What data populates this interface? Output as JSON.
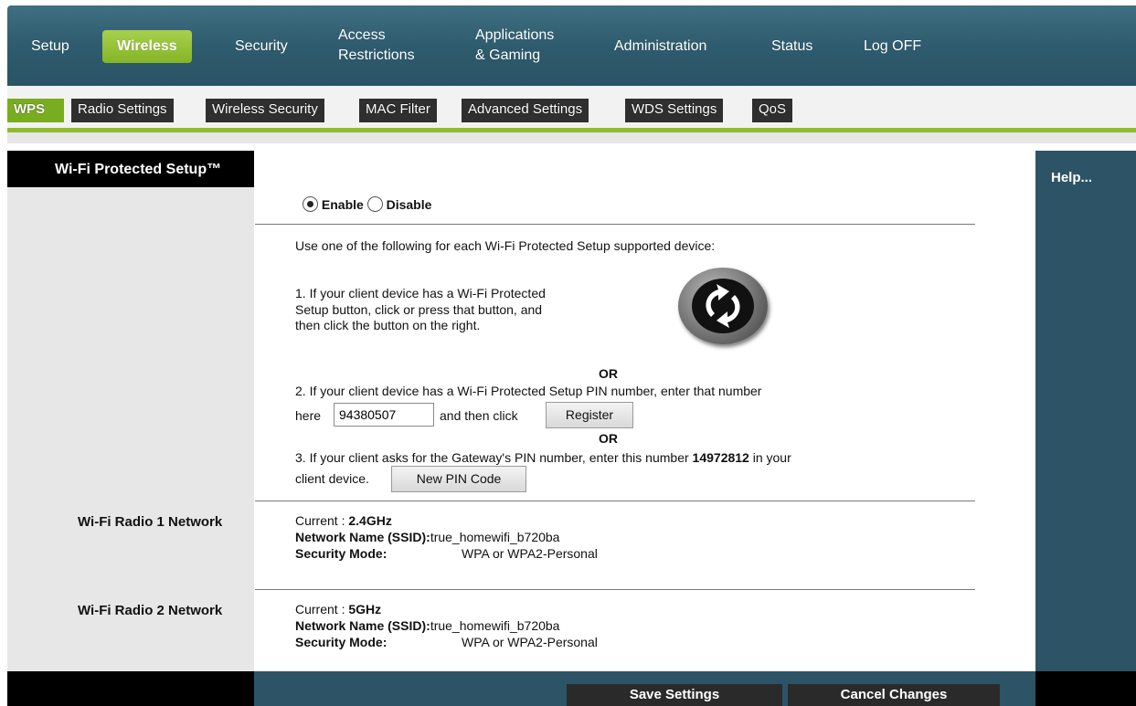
{
  "topnav": {
    "items": [
      {
        "label": "Setup"
      },
      {
        "label": "Wireless",
        "active": true
      },
      {
        "label": "Security"
      },
      {
        "label_line1": "Access",
        "label_line2": "Restrictions"
      },
      {
        "label_line1": "Applications",
        "label_line2": "& Gaming"
      },
      {
        "label": "Administration"
      },
      {
        "label": "Status"
      },
      {
        "label": "Log OFF"
      }
    ]
  },
  "subnav": {
    "tabs": [
      {
        "label": "WPS",
        "active": true
      },
      {
        "label": "Radio Settings"
      },
      {
        "label": "Wireless Security"
      },
      {
        "label": "MAC Filter"
      },
      {
        "label": "Advanced Settings"
      },
      {
        "label": "WDS Settings"
      },
      {
        "label": "QoS"
      }
    ]
  },
  "left": {
    "section_title": "Wi-Fi Protected Setup™",
    "radio1_label": "Wi-Fi Radio 1 Network",
    "radio2_label": "Wi-Fi Radio 2 Network"
  },
  "wps": {
    "enable_label": "Enable",
    "disable_label": "Disable",
    "selected": "Enable",
    "intro": "Use one of the following for each Wi-Fi Protected Setup supported device:",
    "option1_line1": "1. If your client device has a Wi-Fi Protected",
    "option1_line2": "Setup button, click or press that button, and",
    "option1_line3": "then click the button on the right.",
    "or_text": "OR",
    "option2_line1": "2. If your client device has a Wi-Fi Protected Setup PIN number, enter that number",
    "option2_here": "here",
    "pin_value": "94380507",
    "option2_then": "and then click",
    "register_label": "Register",
    "option3_prefix": "3. If your client asks for the Gateway's PIN number, enter this number",
    "gateway_pin": "14972812",
    "option3_suffix": "in your",
    "option3_line2": "client device.",
    "new_pin_label": "New PIN Code"
  },
  "radio1": {
    "current_label": "Current :",
    "current_value": "2.4GHz",
    "ssid_label": "Network Name (SSID):",
    "ssid_value": "true_homewifi_b720ba",
    "security_label": "Security Mode:",
    "security_value": "WPA or WPA2-Personal"
  },
  "radio2": {
    "current_label": "Current :",
    "current_value": "5GHz",
    "ssid_label": "Network Name (SSID):",
    "ssid_value": "true_homewifi_b720ba",
    "security_label": "Security Mode:",
    "security_value": "WPA or WPA2-Personal"
  },
  "right": {
    "help_label": "Help..."
  },
  "footer": {
    "save_label": "Save Settings",
    "cancel_label": "Cancel Changes"
  },
  "colors": {
    "nav_bg": "#2d5a6c",
    "active_green": "#84b427",
    "tab_bg": "#2f2f2f"
  }
}
